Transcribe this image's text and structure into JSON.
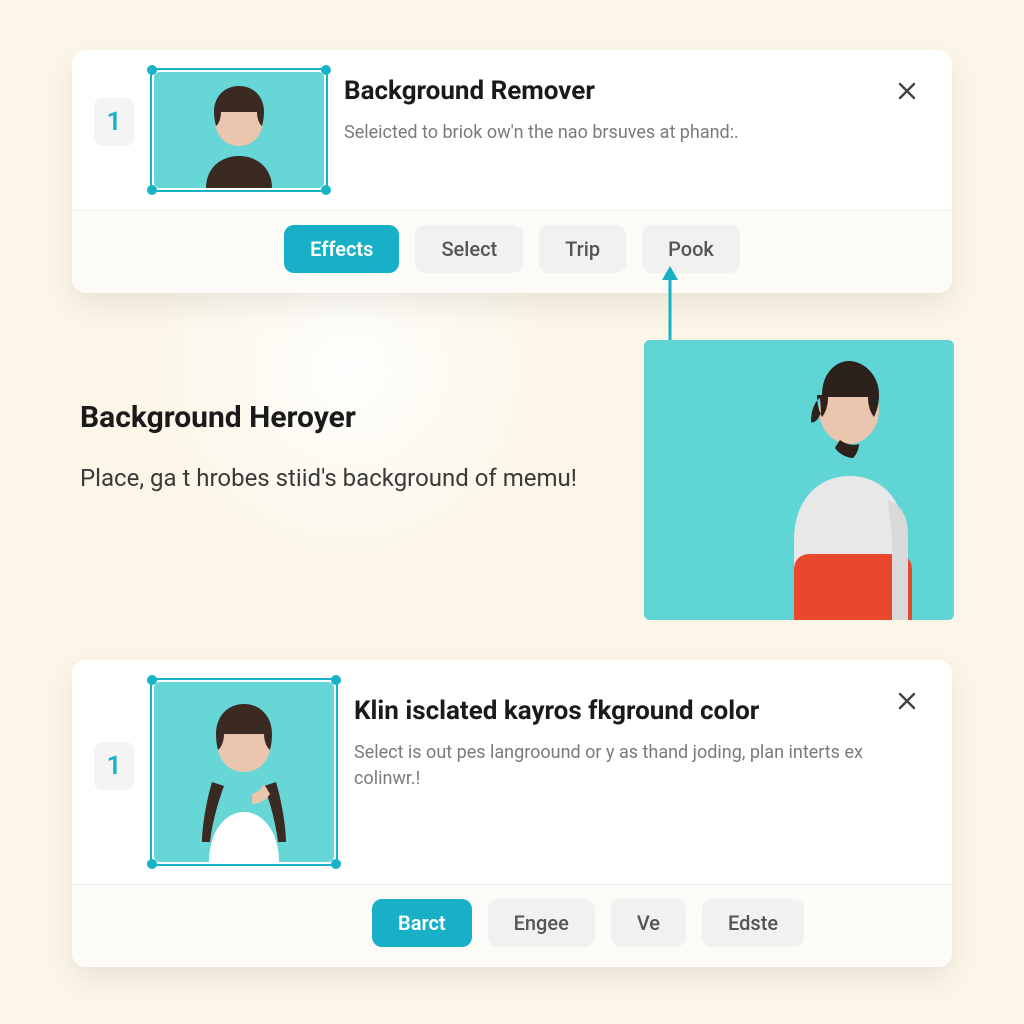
{
  "colors": {
    "accent": "#17b0c6",
    "thumb_bg": "#66d6d6"
  },
  "card1": {
    "step": "1",
    "title": "Background Remover",
    "subtitle": "Seleicted to briok ow'n the nao brsuves at phand:.",
    "tabs": [
      "Effects",
      "Select",
      "Trip",
      "Pook"
    ],
    "active_tab_index": 0
  },
  "mid": {
    "heading": "Background Heroyer",
    "body": "Place, ga t hrobes stiid's background of memu!"
  },
  "card2": {
    "step": "1",
    "title": "Klin isclated kayros fkground color",
    "subtitle": "Select is out pes langroound or y as thand joding, plan interts ex colinwr.!",
    "tabs": [
      "Barct",
      "Engee",
      "Ve",
      "Edste"
    ],
    "active_tab_index": 0
  }
}
